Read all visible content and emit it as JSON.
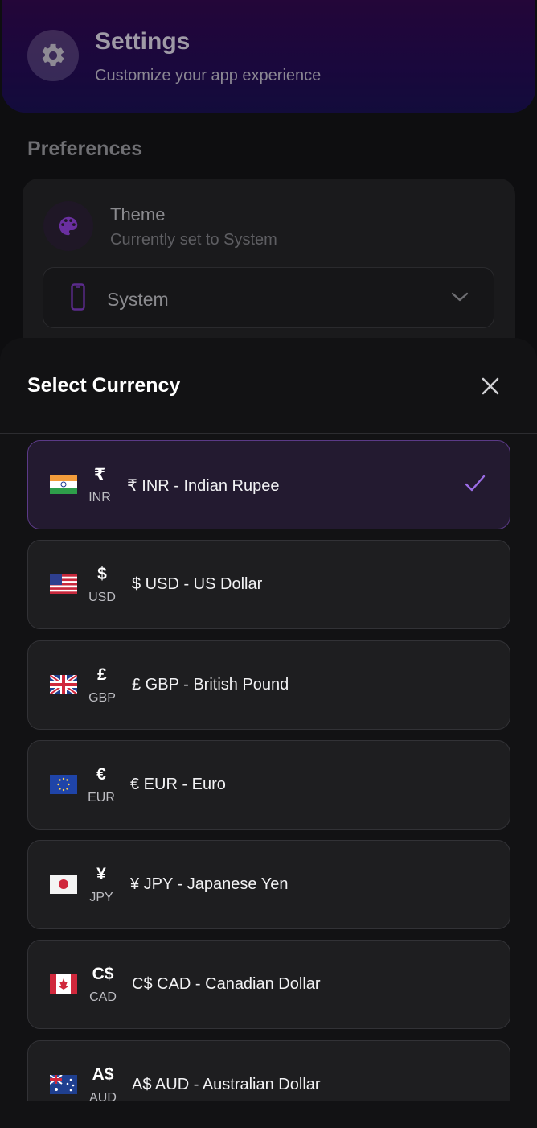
{
  "header": {
    "icon": "gear-icon",
    "title": "Settings",
    "subtitle": "Customize your app experience"
  },
  "preferences": {
    "section_title": "Preferences",
    "theme": {
      "icon": "palette-icon",
      "label": "Theme",
      "subtitle": "Currently set to System",
      "select": {
        "icon": "phone-icon",
        "value": "System"
      }
    }
  },
  "sheet": {
    "title": "Select Currency",
    "close_icon": "close-icon",
    "accent_color": "#9b6ce6",
    "items": [
      {
        "flag": "india",
        "symbol": "₹",
        "code": "INR",
        "label": "₹ INR - Indian Rupee",
        "selected": true
      },
      {
        "flag": "usa",
        "symbol": "$",
        "code": "USD",
        "label": "$ USD - US Dollar",
        "selected": false
      },
      {
        "flag": "uk",
        "symbol": "£",
        "code": "GBP",
        "label": "£ GBP - British Pound",
        "selected": false
      },
      {
        "flag": "eu",
        "symbol": "€",
        "code": "EUR",
        "label": "€ EUR - Euro",
        "selected": false
      },
      {
        "flag": "japan",
        "symbol": "¥",
        "code": "JPY",
        "label": "¥ JPY - Japanese Yen",
        "selected": false
      },
      {
        "flag": "canada",
        "symbol": "C$",
        "code": "CAD",
        "label": "C$ CAD - Canadian Dollar",
        "selected": false
      },
      {
        "flag": "australia",
        "symbol": "A$",
        "code": "AUD",
        "label": "A$ AUD - Australian Dollar",
        "selected": false
      }
    ]
  }
}
